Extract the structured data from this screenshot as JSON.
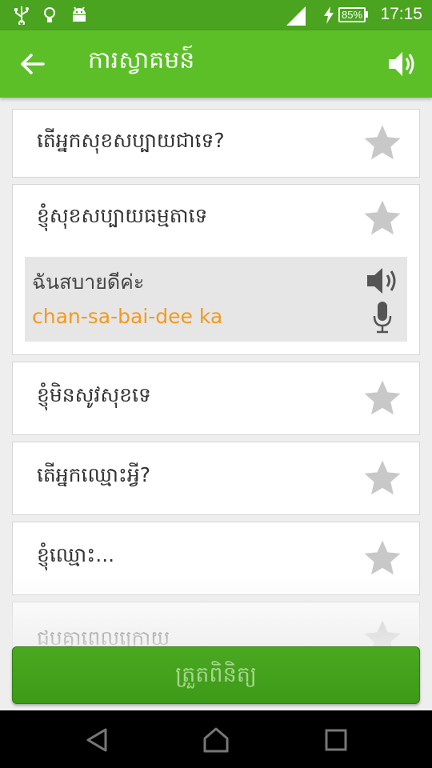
{
  "status_bar": {
    "battery_percent": "85%",
    "time": "17:15",
    "icons": [
      "usb-icon",
      "lightbulb-icon",
      "android-icon",
      "signal-icon",
      "charging-icon",
      "battery-icon"
    ]
  },
  "app_bar": {
    "title": "ការស្វាគមន៍",
    "back_icon": "back-arrow-icon",
    "audio_icon": "speaker-icon"
  },
  "phrases": [
    {
      "text": "តើអ្នកសុខសប្បាយជាទេ?",
      "starred": false
    },
    {
      "text": "ខ្ញុំសុខសប្បាយធម្មតាទេ",
      "starred": false,
      "expanded": true,
      "translation": "ฉันสบายดีค่ะ",
      "romanization": "chan-sa-bai-dee ka"
    },
    {
      "text": "ខ្ញុំមិនសូវសុខទេ",
      "starred": false
    },
    {
      "text": "តើអ្នកឈ្មោះអ្វី?",
      "starred": false
    },
    {
      "text": "ខ្ញុំឈ្មោះ...",
      "starred": false
    },
    {
      "text": "ជួបគ្នាពេលក្រោយ",
      "starred": false
    }
  ],
  "test_button": {
    "label": "ត្រួតពិនិត្យ"
  },
  "colors": {
    "status_bar": "#4aa41f",
    "app_bar": "#5cbf28",
    "romanization": "#f29a1e",
    "star": "#c8c8c8",
    "button": "#43a11c"
  }
}
